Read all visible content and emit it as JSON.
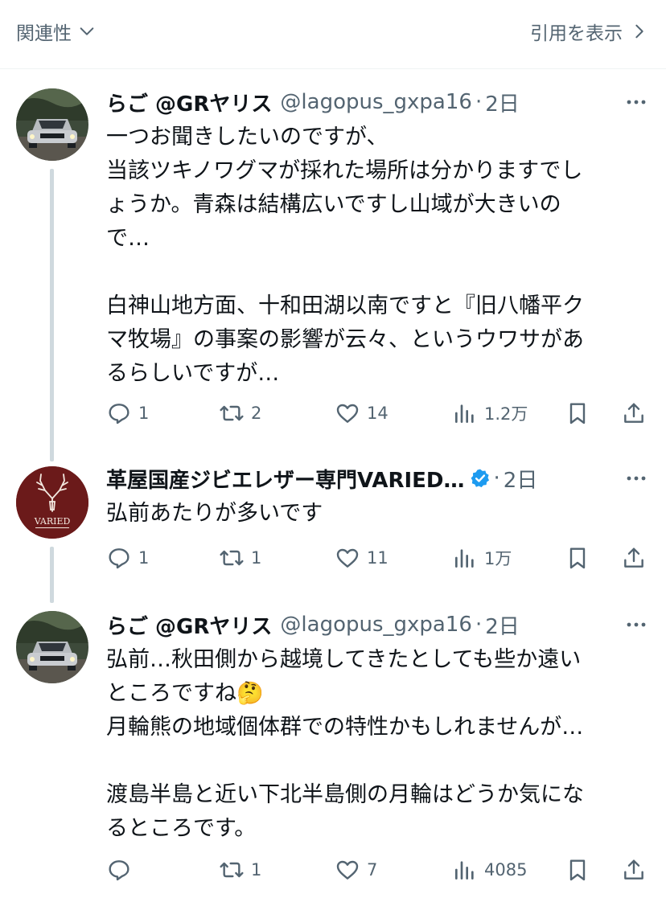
{
  "header": {
    "sort_label": "関連性",
    "quotes_label": "引用を表示"
  },
  "tweets": [
    {
      "name": "らご @GRヤリス",
      "handle": "@lagopus_gxpa16",
      "dot": "·",
      "time": "2日",
      "lines": [
        "一つお聞きしたいのですが、",
        "当該ツキノワグマが採れた場所は分かりますでし",
        "ょうか。青森は結構広いですし山域が大きいの",
        "で…",
        "",
        "白神山地方面、十和田湖以南ですと『旧八幡平ク",
        "マ牧場』の事案の影響が云々、というウワサがあ",
        "るらしいですが…"
      ],
      "replies": "1",
      "retweets": "2",
      "likes": "14",
      "views": "1.2万"
    },
    {
      "name": "革屋国産ジビエレザー専門VARIED…",
      "avatar_text": "VARIED",
      "dot": "·",
      "time": "2日",
      "lines": [
        "弘前あたりが多いです"
      ],
      "replies": "1",
      "retweets": "1",
      "likes": "11",
      "views": "1万"
    },
    {
      "name": "らご @GRヤリス",
      "handle": "@lagopus_gxpa16",
      "dot": "·",
      "time": "2日",
      "lines": [
        "弘前…秋田側から越境してきたとしても些か遠い",
        "ところですね🤔",
        "月輪熊の地域個体群での特性かもしれませんが…",
        "",
        "渡島半島と近い下北半島側の月輪はどうか気にな",
        "るところです。"
      ],
      "replies": "",
      "retweets": "1",
      "likes": "7",
      "views": "4085"
    }
  ],
  "colors": {
    "secondary_text": "#536471",
    "thread_line": "#cfd9de",
    "verified_blue": "#1d9bf0",
    "varied_avatar_bg": "#6b1a1a"
  },
  "icons": [
    "chevron-down-icon",
    "chevron-right-icon",
    "more-icon",
    "reply-icon",
    "retweet-icon",
    "like-icon",
    "views-icon",
    "bookmark-icon",
    "share-icon",
    "verified-icon"
  ]
}
